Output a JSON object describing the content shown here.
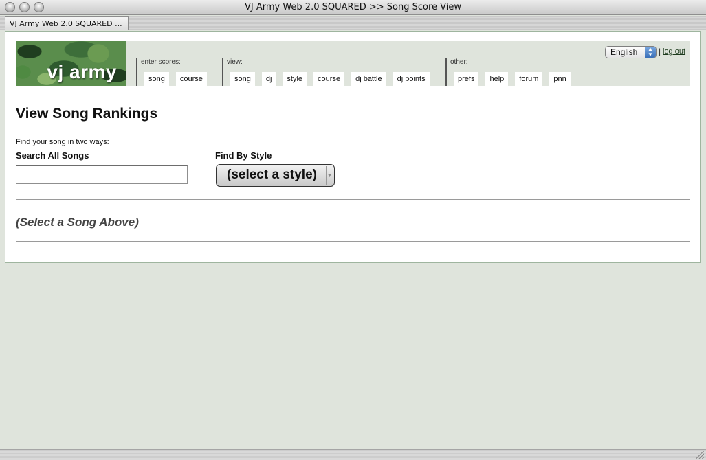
{
  "window": {
    "title": "VJ Army Web 2.0 SQUARED >> Song Score View",
    "tab_label": "VJ Army Web 2.0 SQUARED ..."
  },
  "header": {
    "logo_text": "vj army",
    "groups": [
      {
        "label": "enter scores:",
        "tabs": [
          "song",
          "course"
        ]
      },
      {
        "label": "view:",
        "tabs": [
          "song",
          "dj",
          "style",
          "course",
          "dj battle",
          "dj points"
        ]
      },
      {
        "label": "other:",
        "tabs": [
          "prefs",
          "help",
          "forum",
          "pnn"
        ]
      }
    ],
    "language": "English",
    "separator": "|",
    "logout_label": "log out"
  },
  "main": {
    "title": "View Song Rankings",
    "intro": "Find your song in two ways:",
    "search_label": "Search All Songs",
    "search_value": "",
    "style_label": "Find By Style",
    "style_selected": "(select a style)",
    "select_prompt": "(Select a Song Above)"
  },
  "colors": {
    "page_background": "#dfe4dc",
    "header_background": "#dfe4dc",
    "logo_green": "#5a8d4c"
  }
}
